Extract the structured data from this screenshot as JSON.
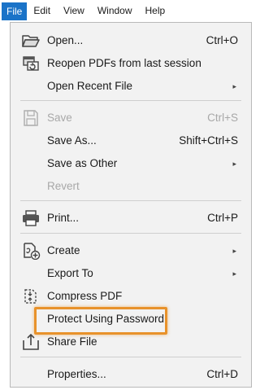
{
  "menubar": {
    "items": [
      "File",
      "Edit",
      "View",
      "Window",
      "Help"
    ]
  },
  "file_menu": {
    "items": {
      "open": {
        "label": "Open...",
        "shortcut": "Ctrl+O",
        "icon": "folder-open-icon"
      },
      "reopen": {
        "label": "Reopen PDFs from last session",
        "icon": "reopen-icon"
      },
      "open_recent": {
        "label": "Open Recent File"
      },
      "save": {
        "label": "Save",
        "shortcut": "Ctrl+S",
        "icon": "save-icon",
        "disabled": true
      },
      "save_as": {
        "label": "Save As...",
        "shortcut": "Shift+Ctrl+S"
      },
      "save_as_other": {
        "label": "Save as Other"
      },
      "revert": {
        "label": "Revert",
        "disabled": true
      },
      "print": {
        "label": "Print...",
        "shortcut": "Ctrl+P",
        "icon": "printer-icon"
      },
      "create": {
        "label": "Create",
        "icon": "create-pdf-icon"
      },
      "export_to": {
        "label": "Export To"
      },
      "compress": {
        "label": "Compress PDF",
        "icon": "compress-icon"
      },
      "protect": {
        "label": "Protect Using Password"
      },
      "share": {
        "label": "Share File",
        "icon": "share-icon"
      },
      "properties": {
        "label": "Properties...",
        "shortcut": "Ctrl+D"
      }
    },
    "submenu_arrow": "▸"
  },
  "colors": {
    "active_menu": "#1a73c8",
    "highlight_box": "#e8922b",
    "disabled_text": "#a8a8a8"
  }
}
